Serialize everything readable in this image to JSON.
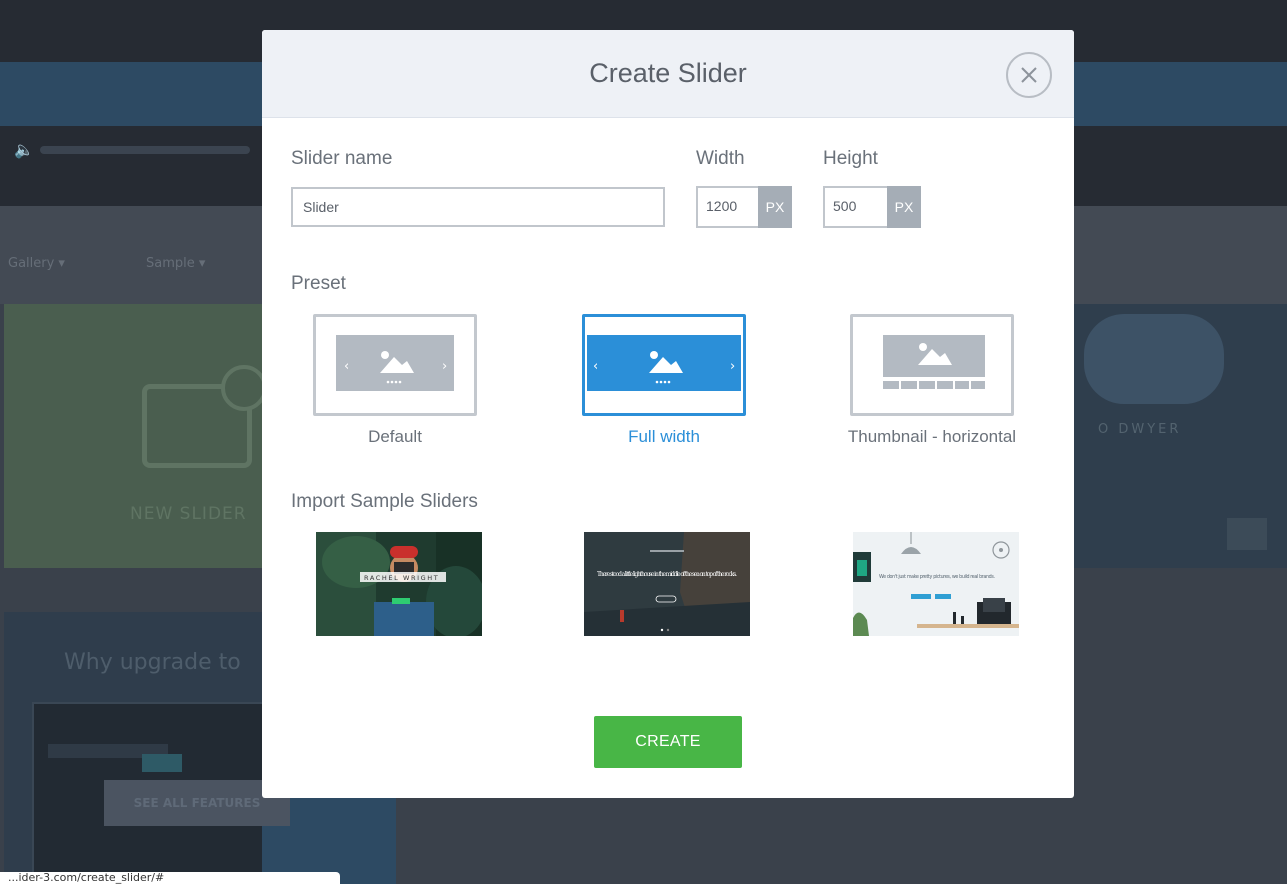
{
  "background": {
    "nav_item_1": "Gallery ▾",
    "nav_item_2": "Sample ▾",
    "new_slider_label": "NEW SLIDER",
    "upgrade_title": "Why upgrade to",
    "see_all_features": "SEE ALL FEATURES",
    "slide_name": "O DWYER",
    "status_url": "...ider-3.com/create_slider/#"
  },
  "modal": {
    "title": "Create Slider",
    "close_icon": "close-icon",
    "slider_name": {
      "label": "Slider name",
      "value": "Slider"
    },
    "width": {
      "label": "Width",
      "value": "1200",
      "unit": "PX"
    },
    "height": {
      "label": "Height",
      "value": "500",
      "unit": "PX"
    },
    "preset_heading": "Preset",
    "presets": [
      {
        "label": "Default",
        "selected": false
      },
      {
        "label": "Full width",
        "selected": true
      },
      {
        "label": "Thumbnail - horizontal",
        "selected": false
      }
    ],
    "import_heading": "Import Sample Sliders",
    "samples": [
      {
        "caption": "RACHEL WRIGHT"
      },
      {
        "caption": "There stood a little lighthouse in the middle of the sea on top of the rocks."
      },
      {
        "caption": "We don't just make pretty pictures, we build real brands."
      }
    ],
    "create_label": "CREATE",
    "accent_color": "#2b8fd8",
    "create_color": "#48b646"
  }
}
